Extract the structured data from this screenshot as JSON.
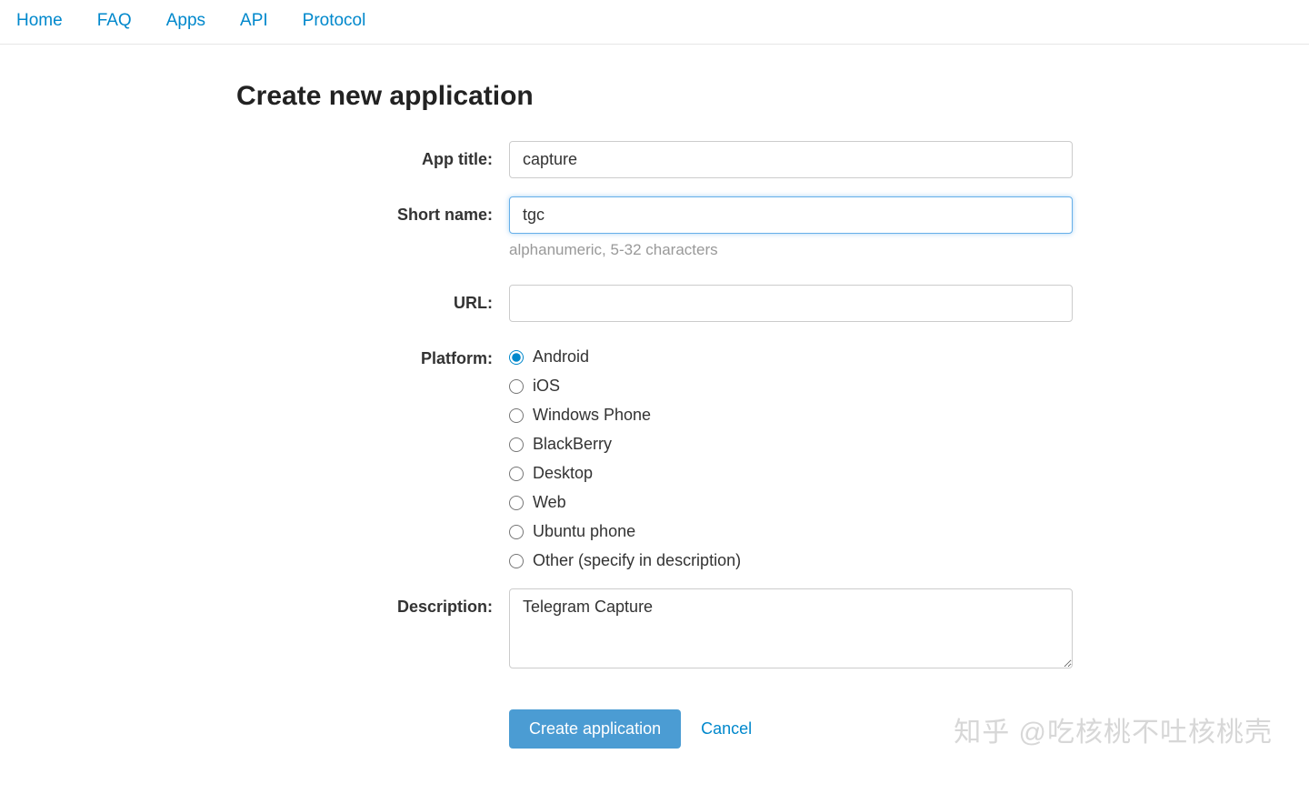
{
  "nav": {
    "items": [
      {
        "label": "Home"
      },
      {
        "label": "FAQ"
      },
      {
        "label": "Apps"
      },
      {
        "label": "API"
      },
      {
        "label": "Protocol"
      }
    ]
  },
  "page": {
    "title": "Create new application"
  },
  "form": {
    "app_title": {
      "label": "App title:",
      "value": "capture"
    },
    "short_name": {
      "label": "Short name:",
      "value": "tgc",
      "help": "alphanumeric, 5-32 characters"
    },
    "url": {
      "label": "URL:",
      "value": ""
    },
    "platform": {
      "label": "Platform:",
      "selected": "Android",
      "options": [
        "Android",
        "iOS",
        "Windows Phone",
        "BlackBerry",
        "Desktop",
        "Web",
        "Ubuntu phone",
        "Other (specify in description)"
      ]
    },
    "description": {
      "label": "Description:",
      "value": "Telegram Capture"
    },
    "actions": {
      "submit": "Create application",
      "cancel": "Cancel"
    }
  },
  "watermark": "知乎 @吃核桃不吐核桃壳"
}
